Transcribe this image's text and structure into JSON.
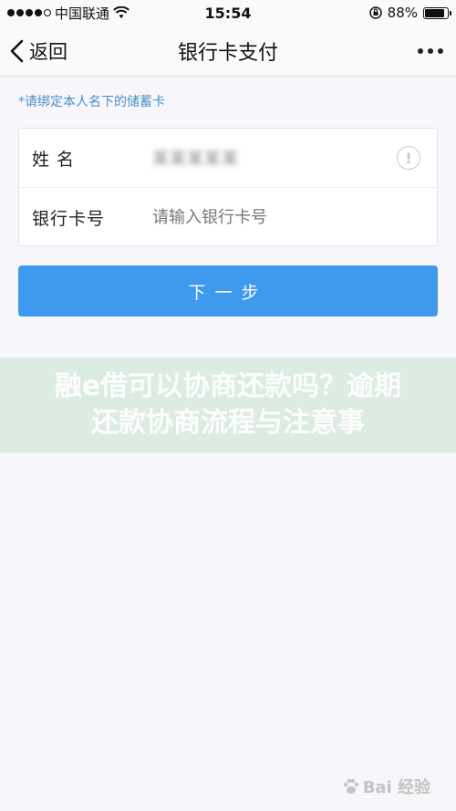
{
  "status_bar": {
    "carrier": "中国联通",
    "time": "15:54",
    "battery_percent": "88%",
    "battery_level": 0.88
  },
  "nav": {
    "back_label": "返回",
    "title": "银行卡支付"
  },
  "hint": "*请绑定本人名下的储蓄卡",
  "form": {
    "name_label": "姓 名",
    "name_value": "某某某某某",
    "card_label": "银行卡号",
    "card_placeholder": "请输入银行卡号"
  },
  "next_button": "下一步",
  "overlay_text": "融e借可以协商还款吗？逾期还款协商流程与注意事",
  "watermark": "Bai 经验",
  "colors": {
    "accent": "#3e99ef",
    "hint": "#4a90c8",
    "background": "#f7f6fa"
  }
}
